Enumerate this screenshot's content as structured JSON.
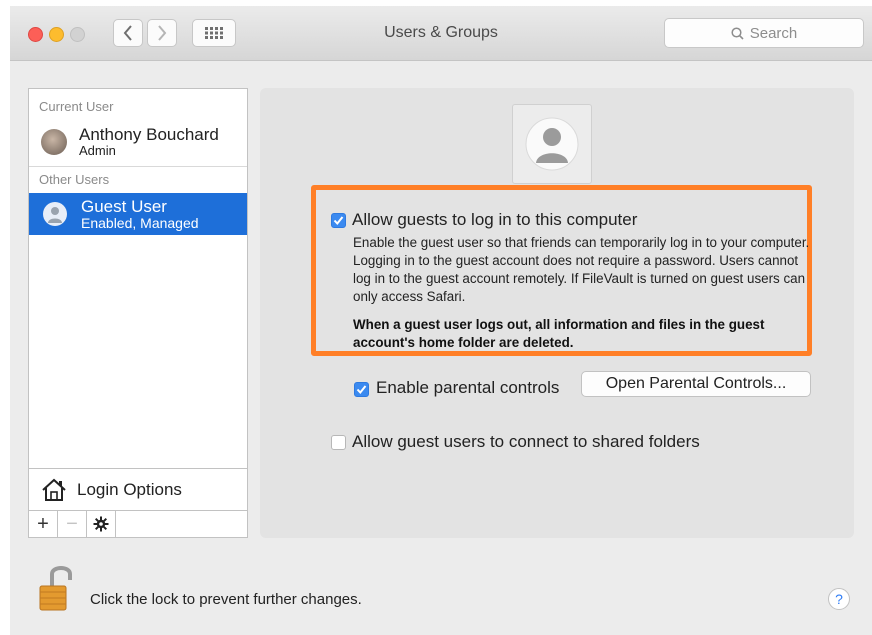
{
  "window": {
    "title": "Users & Groups"
  },
  "toolbar": {
    "search_placeholder": "Search"
  },
  "sidebar": {
    "current_user_label": "Current User",
    "current_user": {
      "name": "Anthony Bouchard",
      "role": "Admin"
    },
    "other_users_label": "Other Users",
    "guest_user": {
      "name": "Guest User",
      "status": "Enabled, Managed"
    },
    "login_options_label": "Login Options",
    "bottom_buttons": [
      "+",
      "−",
      "gear"
    ]
  },
  "panel": {
    "allow_guest_login": {
      "label": "Allow guests to log in to this computer",
      "checked": true
    },
    "description": "Enable the guest user so that friends can temporarily log in to your computer. Logging in to the guest account does not require a password. Users cannot log in to the guest account remotely. If FileVault is turned on guest users can only access Safari.",
    "warning": "When a guest user logs out, all information and files in the guest account's home folder are deleted.",
    "parental_controls": {
      "label": "Enable parental controls",
      "checked": true
    },
    "open_parental_controls_button": "Open Parental Controls...",
    "shared_folders": {
      "label": "Allow guest users to connect to shared folders",
      "checked": false
    }
  },
  "footer": {
    "lock_text": "Click the lock to prevent further changes.",
    "help_label": "?"
  },
  "colors": {
    "selection": "#1e6fd9",
    "highlight_box": "#ff7f27",
    "checkbox": "#3b8af0"
  }
}
